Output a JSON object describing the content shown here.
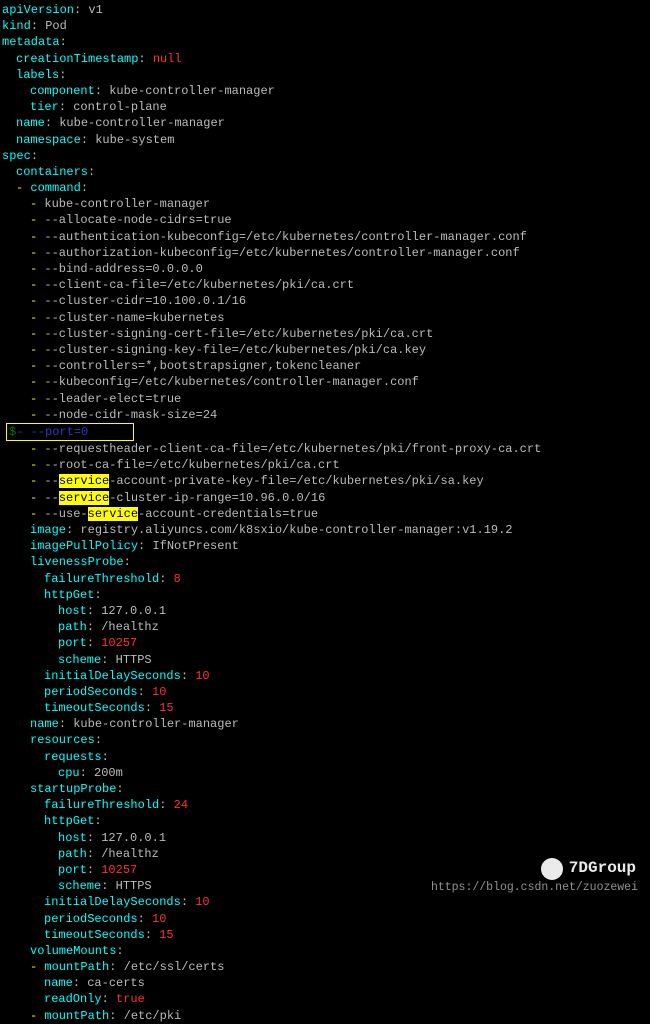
{
  "yaml": {
    "apiVersion": "v1",
    "kind": "Pod",
    "metadata": {
      "creationTimestamp": "null",
      "labels": {
        "component": "kube-controller-manager",
        "tier": "control-plane"
      },
      "name": "kube-controller-manager",
      "namespace": "kube-system"
    },
    "spec": {
      "containers": {
        "command": [
          "kube-controller-manager",
          "--allocate-node-cidrs=true",
          "--authentication-kubeconfig=/etc/kubernetes/controller-manager.conf",
          "--authorization-kubeconfig=/etc/kubernetes/controller-manager.conf",
          "--bind-address=0.0.0.0",
          "--client-ca-file=/etc/kubernetes/pki/ca.crt",
          "--cluster-cidr=10.100.0.1/16",
          "--cluster-name=kubernetes",
          "--cluster-signing-cert-file=/etc/kubernetes/pki/ca.crt",
          "--cluster-signing-key-file=/etc/kubernetes/pki/ca.key",
          "--controllers=*,bootstrapsigner,tokencleaner",
          "--kubeconfig=/etc/kubernetes/controller-manager.conf",
          "--leader-elect=true",
          "--node-cidr-mask-size=24",
          "--requestheader-client-ca-file=/etc/kubernetes/pki/front-proxy-ca.crt",
          "--root-ca-file=/etc/kubernetes/pki/ca.crt"
        ],
        "highlighted_command": "- --port=0",
        "service_lines": {
          "hl": "service",
          "l1a": "--",
          "l1b": "-account-private-key-file=/etc/kubernetes/pki/sa.key",
          "l2a": "--",
          "l2b": "-cluster-ip-range=10.96.0.0/16",
          "l3a": "--use-",
          "l3b": "-account-credentials=true"
        },
        "image_key": "image",
        "image": "registry.aliyuncs.com/k8sxio/kube-controller-manager:v1.19.2",
        "imagePullPolicy_key": "imagePullPolicy",
        "imagePullPolicy": "IfNotPresent",
        "livenessProbe_key": "livenessProbe",
        "livenessProbe": {
          "failureThreshold_key": "failureThreshold",
          "failureThreshold": "8",
          "httpGet_key": "httpGet",
          "httpGet": {
            "host_key": "host",
            "host": "127.0.0.1",
            "path_key": "path",
            "path": "/healthz",
            "port_key": "port",
            "port": "10257",
            "scheme_key": "scheme",
            "scheme": "HTTPS"
          },
          "initialDelaySeconds_key": "initialDelaySeconds",
          "initialDelaySeconds": "10",
          "periodSeconds_key": "periodSeconds",
          "periodSeconds": "10",
          "timeoutSeconds_key": "timeoutSeconds",
          "timeoutSeconds": "15"
        },
        "name_key": "name",
        "name": "kube-controller-manager",
        "resources_key": "resources",
        "resources": {
          "requests_key": "requests",
          "requests": {
            "cpu_key": "cpu",
            "cpu": "200m"
          }
        },
        "startupProbe_key": "startupProbe",
        "startupProbe": {
          "failureThreshold_key": "failureThreshold",
          "failureThreshold": "24",
          "httpGet_key": "httpGet",
          "httpGet": {
            "host_key": "host",
            "host": "127.0.0.1",
            "path_key": "path",
            "path": "/healthz",
            "port_key": "port",
            "port": "10257",
            "scheme_key": "scheme",
            "scheme": "HTTPS"
          },
          "initialDelaySeconds_key": "initialDelaySeconds",
          "initialDelaySeconds": "10",
          "periodSeconds_key": "periodSeconds",
          "periodSeconds": "10",
          "timeoutSeconds_key": "timeoutSeconds",
          "timeoutSeconds": "15"
        },
        "volumeMounts_key": "volumeMounts",
        "volumeMounts": [
          {
            "mountPath_key": "mountPath",
            "mountPath": "/etc/ssl/certs",
            "name_key": "name",
            "name": "ca-certs",
            "readOnly_key": "readOnly",
            "readOnly": "true"
          },
          {
            "mountPath_key": "mountPath",
            "mountPath": "/etc/pki"
          }
        ]
      }
    }
  },
  "keys": {
    "apiVersion": "apiVersion",
    "kind": "kind",
    "metadata": "metadata",
    "creationTimestamp": "creationTimestamp",
    "labels": "labels",
    "component": "component",
    "tier": "tier",
    "name": "name",
    "namespace": "namespace",
    "spec": "spec",
    "containers": "containers",
    "command": "command"
  },
  "dash": "-",
  "watermark": {
    "main": "7DGroup",
    "sub": "https://blog.csdn.net/zuozewei"
  }
}
